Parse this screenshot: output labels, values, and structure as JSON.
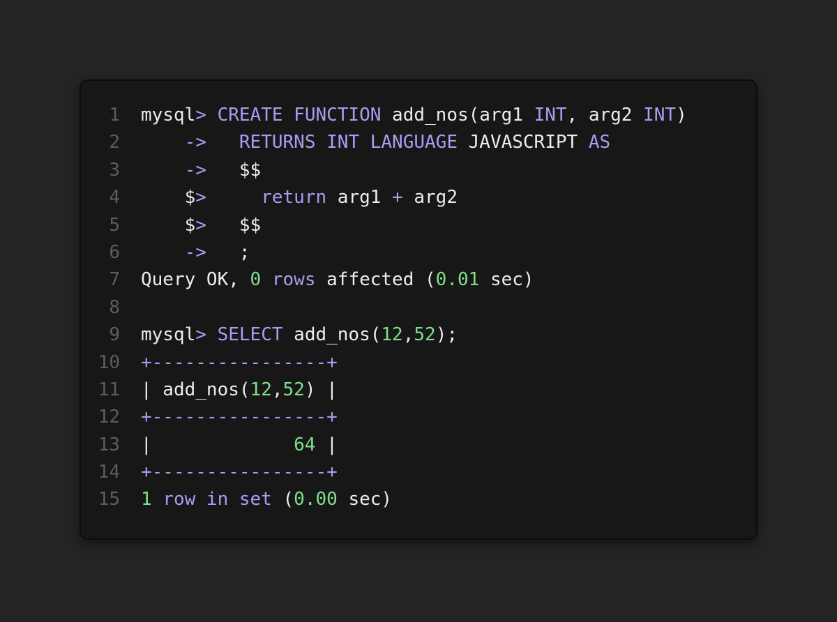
{
  "theme": {
    "background": "#242424",
    "card": "#171717",
    "text": "#ececec",
    "keyword": "#a99cf1",
    "number": "#7ee08a",
    "line_number": "#5d5d5d"
  },
  "code_lines": [
    {
      "n": "1",
      "tokens": [
        {
          "t": "mysql",
          "c": "text"
        },
        {
          "t": "> ",
          "c": "kw"
        },
        {
          "t": "CREATE FUNCTION",
          "c": "kw"
        },
        {
          "t": " add_nos(arg1 ",
          "c": "text"
        },
        {
          "t": "INT",
          "c": "kw"
        },
        {
          "t": ", arg2 ",
          "c": "text"
        },
        {
          "t": "INT",
          "c": "kw"
        },
        {
          "t": ")",
          "c": "text"
        }
      ]
    },
    {
      "n": "2",
      "tokens": [
        {
          "t": "    ",
          "c": "text"
        },
        {
          "t": "->",
          "c": "kw"
        },
        {
          "t": "   ",
          "c": "text"
        },
        {
          "t": "RETURNS INT LANGUAGE",
          "c": "kw"
        },
        {
          "t": " JAVASCRIPT ",
          "c": "text"
        },
        {
          "t": "AS",
          "c": "kw"
        }
      ]
    },
    {
      "n": "3",
      "tokens": [
        {
          "t": "    ",
          "c": "text"
        },
        {
          "t": "->",
          "c": "kw"
        },
        {
          "t": "   $$",
          "c": "text"
        }
      ]
    },
    {
      "n": "4",
      "tokens": [
        {
          "t": "    $",
          "c": "text"
        },
        {
          "t": ">",
          "c": "kw"
        },
        {
          "t": "     ",
          "c": "text"
        },
        {
          "t": "return",
          "c": "kw"
        },
        {
          "t": " arg1 ",
          "c": "text"
        },
        {
          "t": "+",
          "c": "kw"
        },
        {
          "t": " arg2",
          "c": "text"
        }
      ]
    },
    {
      "n": "5",
      "tokens": [
        {
          "t": "    $",
          "c": "text"
        },
        {
          "t": ">",
          "c": "kw"
        },
        {
          "t": "   $$",
          "c": "text"
        }
      ]
    },
    {
      "n": "6",
      "tokens": [
        {
          "t": "    ",
          "c": "text"
        },
        {
          "t": "->",
          "c": "kw"
        },
        {
          "t": "   ;",
          "c": "text"
        }
      ]
    },
    {
      "n": "7",
      "tokens": [
        {
          "t": "Query OK, ",
          "c": "text"
        },
        {
          "t": "0",
          "c": "num"
        },
        {
          "t": " ",
          "c": "text"
        },
        {
          "t": "rows",
          "c": "kw"
        },
        {
          "t": " affected (",
          "c": "text"
        },
        {
          "t": "0.01",
          "c": "num"
        },
        {
          "t": " sec)",
          "c": "text"
        }
      ]
    },
    {
      "n": "8",
      "tokens": []
    },
    {
      "n": "9",
      "tokens": [
        {
          "t": "mysql",
          "c": "text"
        },
        {
          "t": "> ",
          "c": "kw"
        },
        {
          "t": "SELECT",
          "c": "kw"
        },
        {
          "t": " add_nos(",
          "c": "text"
        },
        {
          "t": "12",
          "c": "num"
        },
        {
          "t": ",",
          "c": "text"
        },
        {
          "t": "52",
          "c": "num"
        },
        {
          "t": ");",
          "c": "text"
        }
      ]
    },
    {
      "n": "10",
      "tokens": [
        {
          "t": "+----------------+",
          "c": "kw"
        }
      ]
    },
    {
      "n": "11",
      "tokens": [
        {
          "t": "| add_nos(",
          "c": "text"
        },
        {
          "t": "12",
          "c": "num"
        },
        {
          "t": ",",
          "c": "text"
        },
        {
          "t": "52",
          "c": "num"
        },
        {
          "t": ") |",
          "c": "text"
        }
      ]
    },
    {
      "n": "12",
      "tokens": [
        {
          "t": "+----------------+",
          "c": "kw"
        }
      ]
    },
    {
      "n": "13",
      "tokens": [
        {
          "t": "|             ",
          "c": "text"
        },
        {
          "t": "64",
          "c": "num"
        },
        {
          "t": " |",
          "c": "text"
        }
      ]
    },
    {
      "n": "14",
      "tokens": [
        {
          "t": "+----------------+",
          "c": "kw"
        }
      ]
    },
    {
      "n": "15",
      "tokens": [
        {
          "t": "1",
          "c": "num"
        },
        {
          "t": " ",
          "c": "text"
        },
        {
          "t": "row in set",
          "c": "kw"
        },
        {
          "t": " (",
          "c": "text"
        },
        {
          "t": "0.00",
          "c": "num"
        },
        {
          "t": " sec)",
          "c": "text"
        }
      ]
    }
  ]
}
